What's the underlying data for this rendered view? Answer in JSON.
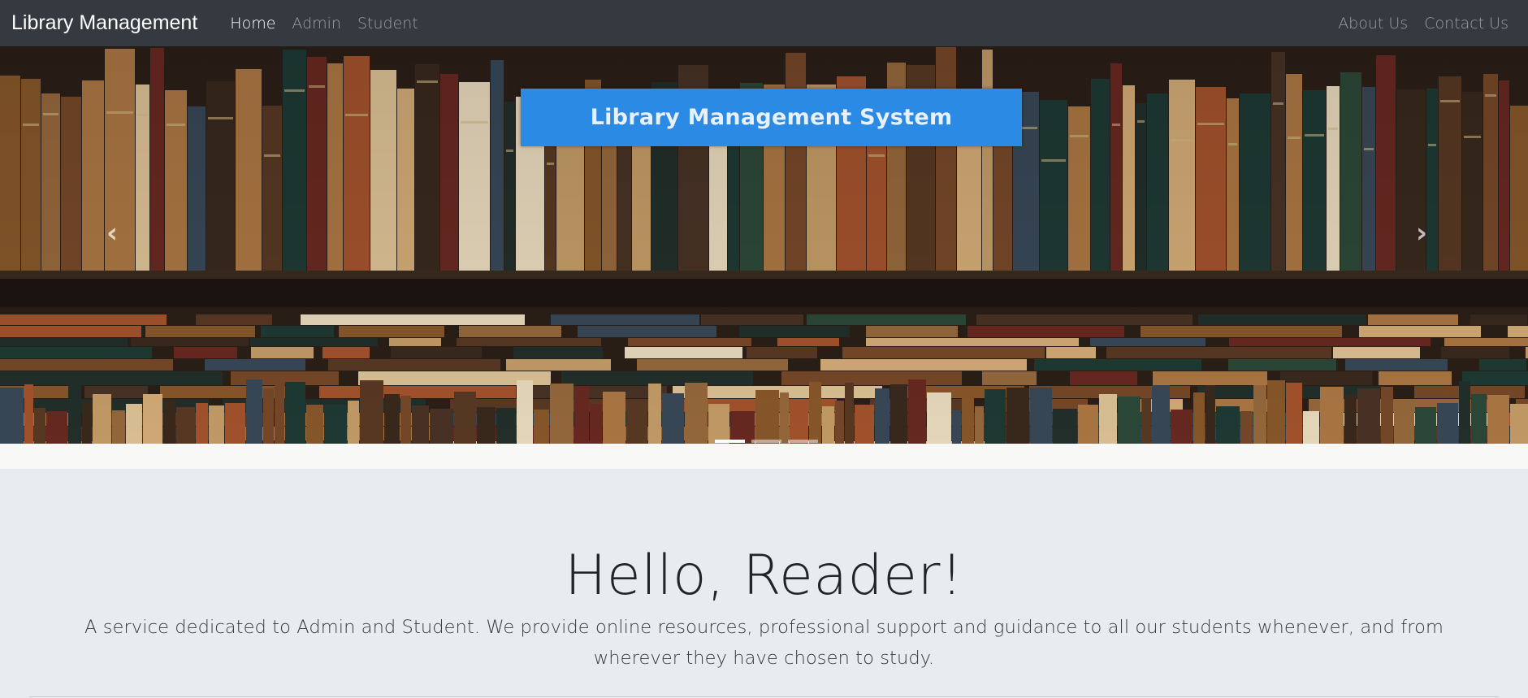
{
  "navbar": {
    "brand": "Library Management",
    "left_links": [
      {
        "label": "Home",
        "active": true
      },
      {
        "label": "Admin",
        "active": false
      },
      {
        "label": "Student",
        "active": false
      }
    ],
    "right_links": [
      {
        "label": "About Us"
      },
      {
        "label": "Contact Us"
      }
    ]
  },
  "carousel": {
    "banner_text": "Library Management System",
    "prev_icon": "chevron-left-icon",
    "next_icon": "chevron-right-icon",
    "slide_count": 3,
    "active_slide": 1
  },
  "jumbotron": {
    "heading": "Hello, Reader!",
    "lead": "A service dedicated to Admin and Student. We provide online resources, professional support and guidance to all our students whenever, and from wherever they have chosen to study."
  },
  "colors": {
    "navbar_bg": "#343a40",
    "banner_bg": "#2b8ae3",
    "page_bg": "#e9ecef"
  }
}
